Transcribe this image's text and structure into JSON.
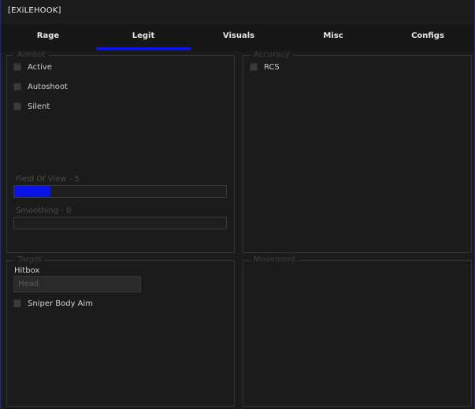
{
  "window": {
    "title": "[EXiLEHOOK]"
  },
  "tabs": [
    {
      "label": "Rage",
      "active": false
    },
    {
      "label": "Legit",
      "active": true
    },
    {
      "label": "Visuals",
      "active": false
    },
    {
      "label": "Misc",
      "active": false
    },
    {
      "label": "Configs",
      "active": false
    }
  ],
  "accent_color": "#0a14e6",
  "aimbot": {
    "title": "Aimbot",
    "checkboxes": [
      {
        "label": "Active",
        "checked": false
      },
      {
        "label": "Autoshoot",
        "checked": false
      },
      {
        "label": "Silent",
        "checked": false
      }
    ],
    "fov": {
      "label": "Field Of View - 5",
      "value": 5,
      "fill_fraction": 0.17
    },
    "smoothing": {
      "label": "Smoothing - 0",
      "value": 0,
      "fill_fraction": 0.0
    }
  },
  "accuracy": {
    "title": "Accuracy",
    "checkboxes": [
      {
        "label": "RCS",
        "checked": false
      }
    ]
  },
  "target": {
    "title": "Target",
    "hitbox_label": "Hitbox",
    "hitbox_value": "Head",
    "checkboxes": [
      {
        "label": "Sniper Body Aim",
        "checked": false
      }
    ]
  },
  "movement": {
    "title": "Movement"
  }
}
